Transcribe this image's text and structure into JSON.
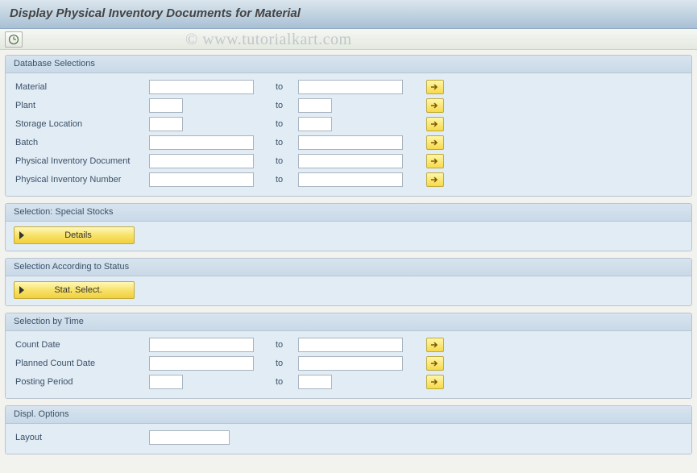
{
  "title": "Display Physical Inventory Documents for Material",
  "watermark": "© www.tutorialkart.com",
  "to_label": "to",
  "groups": {
    "db": {
      "title": "Database Selections",
      "rows": {
        "material": {
          "label": "Material"
        },
        "plant": {
          "label": "Plant"
        },
        "storage_loc": {
          "label": "Storage Location"
        },
        "batch": {
          "label": "Batch"
        },
        "pi_doc": {
          "label": "Physical Inventory Document"
        },
        "pi_num": {
          "label": "Physical Inventory Number"
        }
      }
    },
    "special": {
      "title": "Selection: Special Stocks",
      "button": "Details"
    },
    "status": {
      "title": "Selection According to Status",
      "button": "Stat. Select."
    },
    "time": {
      "title": "Selection by Time",
      "rows": {
        "count_date": {
          "label": "Count Date"
        },
        "planned_date": {
          "label": "Planned Count Date"
        },
        "posting_period": {
          "label": "Posting Period"
        }
      }
    },
    "displ": {
      "title": "Displ. Options",
      "rows": {
        "layout": {
          "label": "Layout"
        }
      }
    }
  }
}
